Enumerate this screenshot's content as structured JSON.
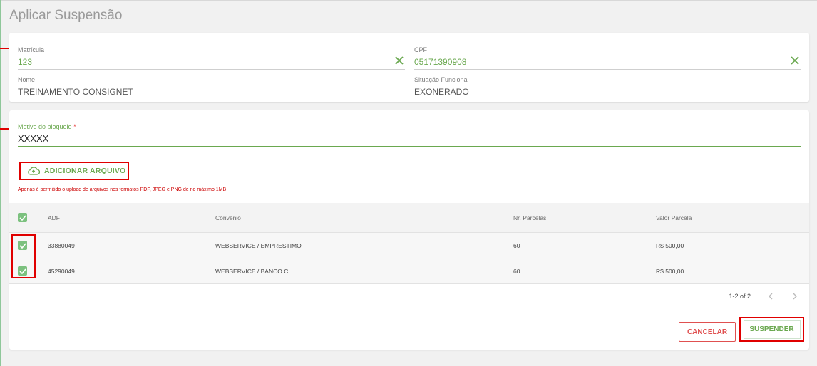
{
  "page": {
    "title": "Aplicar Suspensão"
  },
  "servidor": {
    "matricula": {
      "label": "Matrícula",
      "value": "123"
    },
    "cpf": {
      "label": "CPF",
      "value": "05171390908"
    },
    "nome": {
      "label": "Nome",
      "value": "TREINAMENTO CONSIGNET"
    },
    "situacao": {
      "label": "Situação Funcional",
      "value": "EXONERADO"
    }
  },
  "motivo": {
    "label": "Motivo do bloqueio",
    "required_mark": "*",
    "value": "XXXXX"
  },
  "upload": {
    "button_label": "ADICIONAR ARQUIVO",
    "hint": "Apenas é permitido o upload de arquivos nos formatos PDF, JPEG e PNG de no máximo 1MB"
  },
  "table": {
    "headers": {
      "adf": "ADF",
      "convenio": "Convênio",
      "parcelas": "Nr. Parcelas",
      "valor": "Valor Parcela"
    },
    "rows": [
      {
        "adf": "33880049",
        "convenio": "WEBSERVICE / EMPRESTIMO",
        "parcelas": "60",
        "valor": "R$ 500,00",
        "checked": true
      },
      {
        "adf": "45290049",
        "convenio": "WEBSERVICE / BANCO C",
        "parcelas": "60",
        "valor": "R$ 500,00",
        "checked": true
      }
    ]
  },
  "pagination": {
    "range": "1-2 of 2"
  },
  "actions": {
    "cancel_label": "CANCELAR",
    "suspend_label": "SUSPENDER"
  },
  "colors": {
    "accent_green": "#6aa84f",
    "checkbox_green": "#7cc17f",
    "highlight_red": "#e00000",
    "danger_red": "#e05050"
  }
}
